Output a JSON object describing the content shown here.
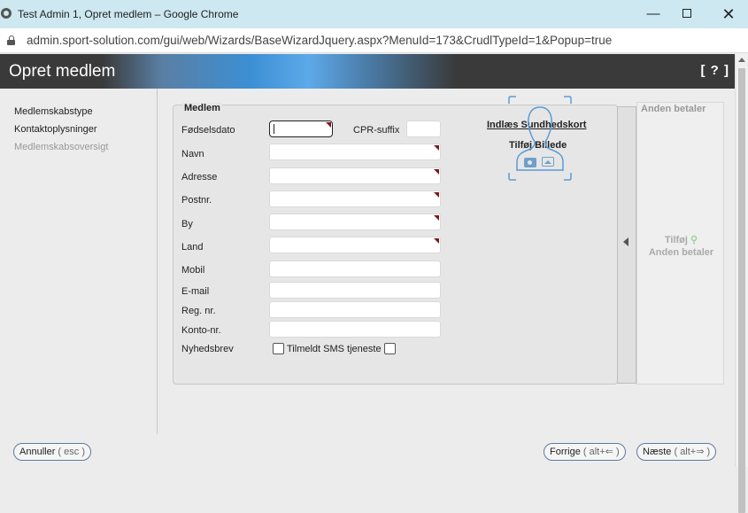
{
  "window": {
    "title": "Test Admin 1, Opret medlem – Google Chrome",
    "url": "admin.sport-solution.com/gui/web/Wizards/BaseWizardJquery.aspx?MenuId=173&CrudlTypeId=1&Popup=true"
  },
  "header": {
    "title": "Opret medlem",
    "help": "[ ? ]"
  },
  "sidebar": {
    "items": [
      {
        "label": "Medlemskabstype"
      },
      {
        "label": "Kontaktoplysninger"
      },
      {
        "label": "Medlemskabsoversigt"
      }
    ]
  },
  "form": {
    "legend": "Medlem",
    "fields": {
      "birthdate": {
        "label": "Fødselsdato",
        "value": ""
      },
      "cpr_suffix": {
        "label": "CPR-suffix",
        "value": ""
      },
      "name": {
        "label": "Navn",
        "value": ""
      },
      "address": {
        "label": "Adresse",
        "value": ""
      },
      "postal": {
        "label": "Postnr.",
        "value": ""
      },
      "city": {
        "label": "By",
        "value": ""
      },
      "country": {
        "label": "Land",
        "value": ""
      },
      "mobile": {
        "label": "Mobil",
        "value": ""
      },
      "email": {
        "label": "E-mail",
        "value": ""
      },
      "reg_no": {
        "label": "Reg. nr.",
        "value": ""
      },
      "account_no": {
        "label": "Konto-nr.",
        "value": ""
      }
    },
    "newsletter_label": "Nyhedsbrev",
    "sms_label": "Tilmeldt SMS tjeneste",
    "newsletter_checked": false,
    "sms_checked": false
  },
  "photo": {
    "load_health_card": "Indlæs Sundhedskort",
    "add_photo": "Tilføj Billede",
    "icons": [
      "camera-icon",
      "image-icon"
    ]
  },
  "other_payer": {
    "title": "Anden betaler",
    "add_line1": "Tilføj",
    "add_line2": "Anden betaler"
  },
  "footer": {
    "cancel": {
      "label": "Annuller",
      "hint": "( esc )"
    },
    "prev": {
      "label": "Forrige",
      "hint": "( alt+⇐ )"
    },
    "next": {
      "label": "Næste",
      "hint": "( alt+⇒ )"
    }
  },
  "colors": {
    "required_marker": "#7a1b1b",
    "accent_blue": "#3c8fd4",
    "button_border": "#5b7ba2"
  }
}
